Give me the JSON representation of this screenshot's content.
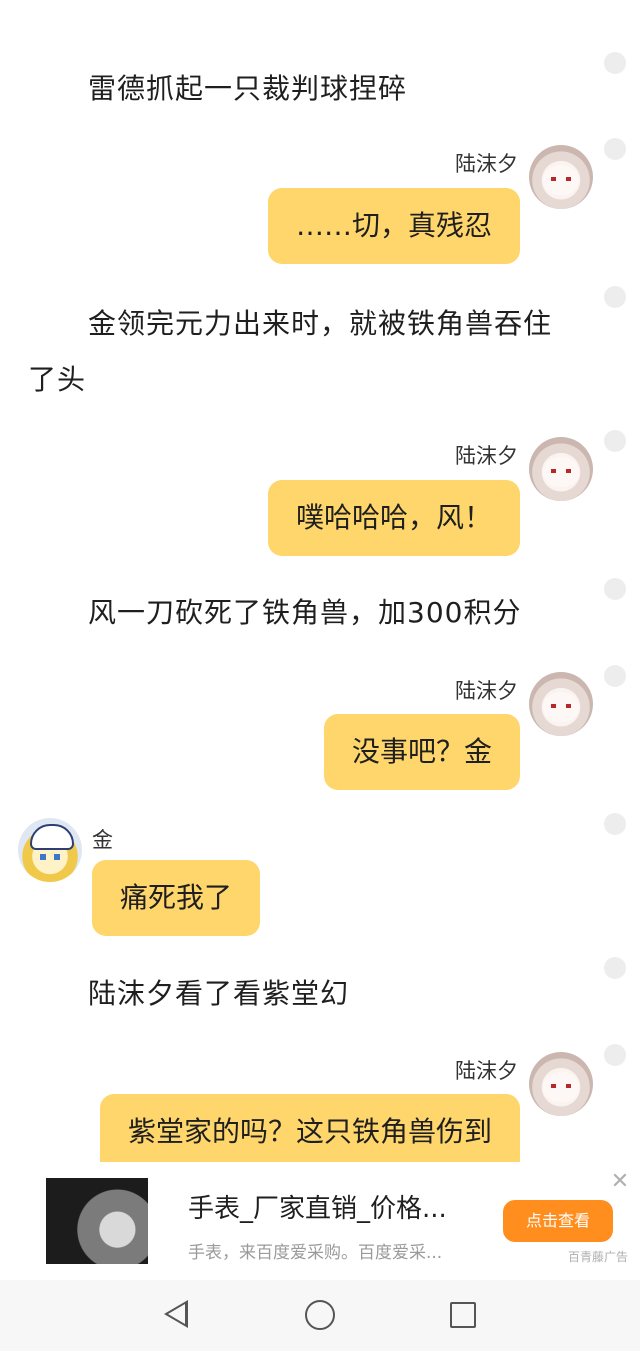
{
  "messages": {
    "n1": "雷德抓起一只裁判球捏碎",
    "m1": {
      "sender": "陆沫夕",
      "text": "……切，真残忍"
    },
    "n2": "金领完元力出来时，就被铁角兽吞住了头",
    "m2": {
      "sender": "陆沫夕",
      "text": "噗哈哈哈，风！"
    },
    "n3": "风一刀砍死了铁角兽，加300积分",
    "m3": {
      "sender": "陆沫夕",
      "text": "没事吧？金"
    },
    "m4": {
      "sender": "金",
      "text": "痛死我了"
    },
    "n4": "陆沫夕看了看紫堂幻",
    "m5": {
      "sender": "陆沫夕",
      "text": "紫堂家的吗？这只铁角兽伤到"
    }
  },
  "ad": {
    "title": "手表_厂家直销_价格...",
    "description": "手表，来百度爱采购。百度爱采...",
    "cta": "点击查看",
    "source": "百青藤广告",
    "close": "✕"
  },
  "icons": {
    "ad_thumb": "wristwatch-image",
    "back": "back-triangle-icon",
    "home": "home-circle-icon",
    "recent": "recent-square-icon"
  },
  "colors": {
    "bubble": "#ffd66b",
    "cta": "#ff8e1f"
  }
}
